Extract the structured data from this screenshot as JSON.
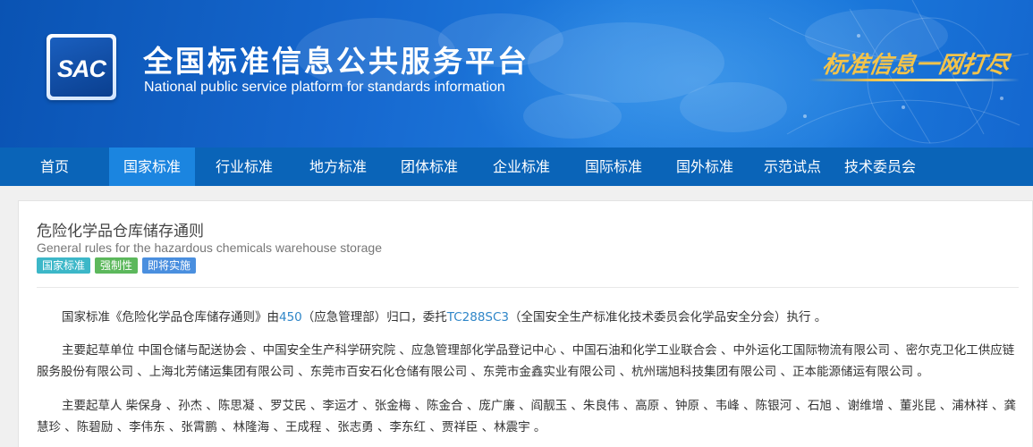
{
  "header": {
    "logo_text": "SAC",
    "site_title": "全国标准信息公共服务平台",
    "site_subtitle": "National public service platform  for standards information",
    "slogan": "标准信息一网打尽"
  },
  "nav": {
    "items": [
      {
        "label": "首页",
        "active": false
      },
      {
        "label": "国家标准",
        "active": true
      },
      {
        "label": "行业标准",
        "active": false
      },
      {
        "label": "地方标准",
        "active": false
      },
      {
        "label": "团体标准",
        "active": false
      },
      {
        "label": "企业标准",
        "active": false
      },
      {
        "label": "国际标准",
        "active": false
      },
      {
        "label": "国外标准",
        "active": false
      },
      {
        "label": "示范试点",
        "active": false
      },
      {
        "label": "技术委员会",
        "active": false
      }
    ]
  },
  "document": {
    "title": "危险化学品仓库储存通则",
    "title_en": "General rules for the hazardous chemicals warehouse storage",
    "badges": {
      "category": "国家标准",
      "requirement": "强制性",
      "status": "即将实施"
    },
    "governance": {
      "prefix": "国家标准《危险化学品仓库储存通则》由",
      "dept_code": "450",
      "dept_name": "（应急管理部）归口，委托",
      "committee_code": "TC288SC3",
      "committee_name": "（全国安全生产标准化技术委员会化学品安全分会）执行 。"
    },
    "drafting_units": "主要起草单位 中国仓储与配送协会 、中国安全生产科学研究院 、应急管理部化学品登记中心 、中国石油和化学工业联合会 、中外运化工国际物流有限公司 、密尔克卫化工供应链服务股份有限公司 、上海北芳储运集团有限公司 、东莞市百安石化仓储有限公司 、东莞市金鑫实业有限公司 、杭州瑞旭科技集团有限公司 、正本能源储运有限公司 。",
    "drafters": "主要起草人 柴保身 、孙杰 、陈思凝 、罗艾民 、李运才 、张金梅 、陈金合 、庞广廉 、阎靓玉 、朱良伟 、高原 、钟原 、韦峰 、陈银河 、石旭 、谢维增 、董兆昆 、浦林祥 、龚慧珍 、陈碧励 、李伟东 、张霄鹏 、林隆海 、王成程 、张志勇 、李东红 、贾祥臣 、林震宇 。"
  },
  "colors": {
    "banner": "#1668cf",
    "nav_bg": "#0a64b8",
    "nav_active": "#1b85e0",
    "link": "#2f86c8",
    "badge_category": "#3cb7c8",
    "badge_requirement": "#5cb85c",
    "badge_status": "#4a8fdf",
    "slogan": "#f3c34a"
  }
}
